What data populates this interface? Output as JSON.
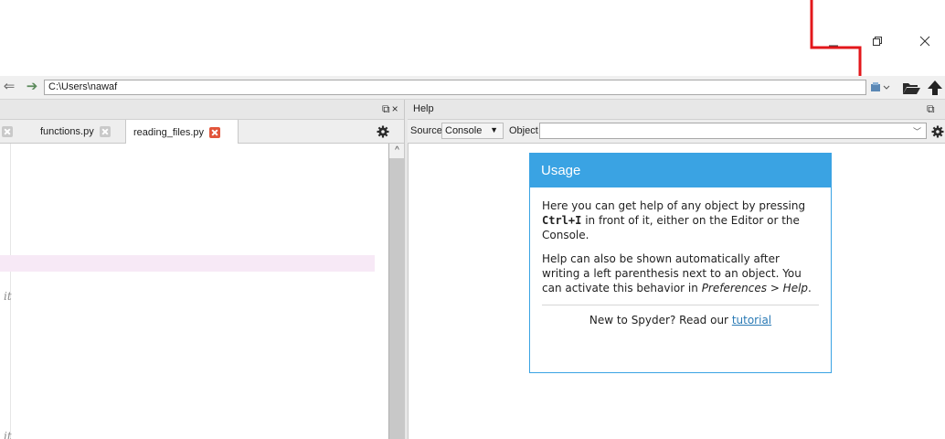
{
  "window": {
    "minimize_icon": "minimize-icon",
    "restore_icon": "restore-icon",
    "close_icon": "close-icon"
  },
  "toolbar": {
    "path_value": "C:\\Users\\nawaf",
    "back_icon": "back-arrow-icon",
    "forward_icon": "forward-arrow-icon",
    "open_folder_icon": "folder-open-icon",
    "parent_dir_icon": "up-arrow-icon"
  },
  "editor": {
    "tabs": [
      {
        "label": "functions.py",
        "active": false
      },
      {
        "label": "reading_files.py",
        "active": true
      }
    ],
    "code_lines": [
      "it",
      "it"
    ]
  },
  "help": {
    "title": "Help",
    "source_label": "Source",
    "source_value": "Console",
    "object_label": "Object",
    "object_value": "",
    "usage": {
      "header": "Usage",
      "p1_a": "Here you can get help of any object by pressing",
      "p1_key": "Ctrl+I",
      "p1_b": "in front of it, either on the Editor or the Console.",
      "p2_a": "Help can also be shown automatically after writing a left parenthesis next to an object. You can activate this behavior in",
      "p2_pref": "Preferences > Help",
      "p2_b": ".",
      "footer_text": "New to Spyder? Read our",
      "footer_link": "tutorial"
    }
  },
  "colors": {
    "accent": "#3aa3e3",
    "annotation": "#e3171b",
    "close_tab_red": "#e2553b"
  }
}
